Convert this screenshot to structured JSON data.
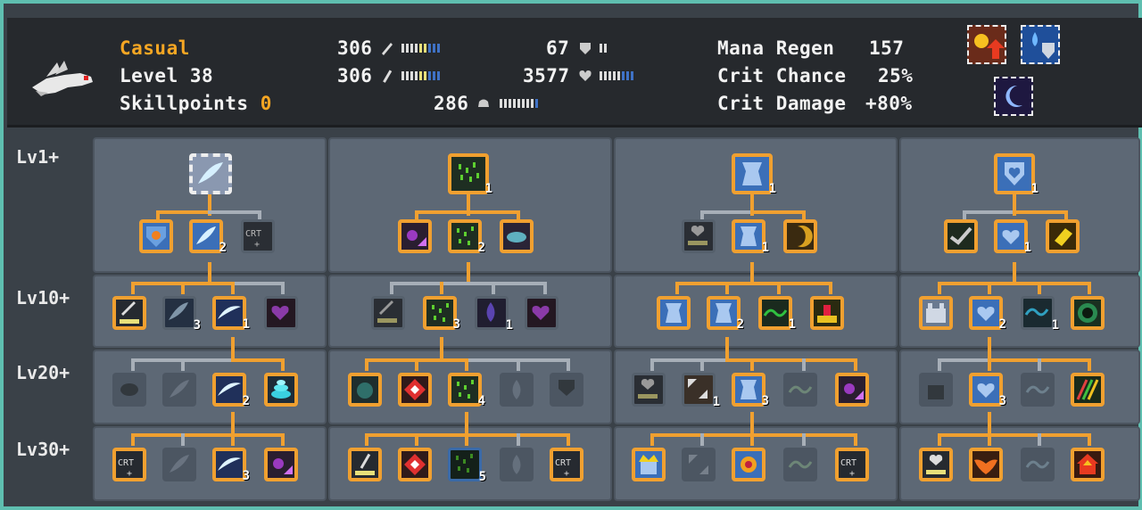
{
  "header": {
    "difficulty": "Casual",
    "level": "Level 38",
    "skillpoints_label": "Skillpoints",
    "skillpoints_value": "0",
    "stat_attack": "306",
    "stat_magic": "306",
    "stat_defense": "67",
    "stat_health": "3577",
    "stat_speed": "286",
    "mana_regen_label": "Mana Regen",
    "mana_regen_value": "157",
    "crit_chance_label": "Crit Chance",
    "crit_chance_value": "25%",
    "crit_damage_label": "Crit Damage",
    "crit_damage_value": "+80%"
  },
  "rows": [
    "Lv1+",
    "Lv10+",
    "Lv20+",
    "Lv30+"
  ],
  "levels": {
    "c1_top": "",
    "c1_r1b": "2",
    "c1_r2c": "3",
    "c1_r2d": "1",
    "c1_r3c": "2",
    "c1_r4c": "3",
    "c2_top": "1",
    "c2_r1b": "2",
    "c2_r2b": "3",
    "c2_r2c": "1",
    "c2_r3c": "4",
    "c2_r4c": "5",
    "c3_top": "1",
    "c3_r1b": "1",
    "c3_r2b": "2",
    "c3_r2c": "1",
    "c3_r3b": "1",
    "c3_r3c": "3",
    "c4_top": "1",
    "c4_r1b": "1",
    "c4_r2b": "2",
    "c4_r2c": "1",
    "c4_r3b": "3"
  },
  "colors": {
    "accent": "#f0a030",
    "panel": "#5d6875",
    "header": "#26292d",
    "border": "#5fbfb0"
  }
}
